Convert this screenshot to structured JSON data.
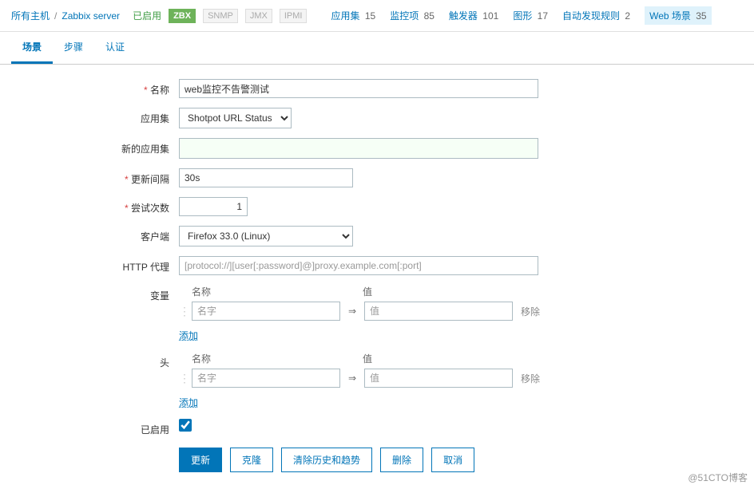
{
  "breadcrumb": {
    "all_hosts": "所有主机",
    "host": "Zabbix server",
    "enabled": "已启用",
    "badges": [
      "ZBX",
      "SNMP",
      "JMX",
      "IPMI"
    ],
    "links": [
      {
        "label": "应用集",
        "count": "15"
      },
      {
        "label": "监控项",
        "count": "85"
      },
      {
        "label": "触发器",
        "count": "101"
      },
      {
        "label": "图形",
        "count": "17"
      },
      {
        "label": "自动发现规则",
        "count": "2"
      },
      {
        "label": "Web 场景",
        "count": "35",
        "active": true
      }
    ]
  },
  "tabs": [
    "场景",
    "步骤",
    "认证"
  ],
  "form": {
    "name_label": "名称",
    "name_value": "web监控不告警测试",
    "app_label": "应用集",
    "app_value": "Shotpot URL Status",
    "newapp_label": "新的应用集",
    "newapp_value": "",
    "interval_label": "更新间隔",
    "interval_value": "30s",
    "retries_label": "尝试次数",
    "retries_value": "1",
    "agent_label": "客户端",
    "agent_value": "Firefox 33.0 (Linux)",
    "proxy_label": "HTTP 代理",
    "proxy_placeholder": "[protocol://][user[:password]@]proxy.example.com[:port]",
    "vars_label": "变量",
    "headers_label": "头",
    "kv_name_header": "名称",
    "kv_value_header": "值",
    "kv_name_placeholder": "名字",
    "kv_value_placeholder": "值",
    "kv_arrow": "⇒",
    "kv_remove": "移除",
    "kv_add": "添加",
    "enabled_label": "已启用"
  },
  "buttons": {
    "update": "更新",
    "clone": "克隆",
    "clear": "清除历史和趋势",
    "delete": "删除",
    "cancel": "取消"
  },
  "watermark": "@51CTO博客"
}
